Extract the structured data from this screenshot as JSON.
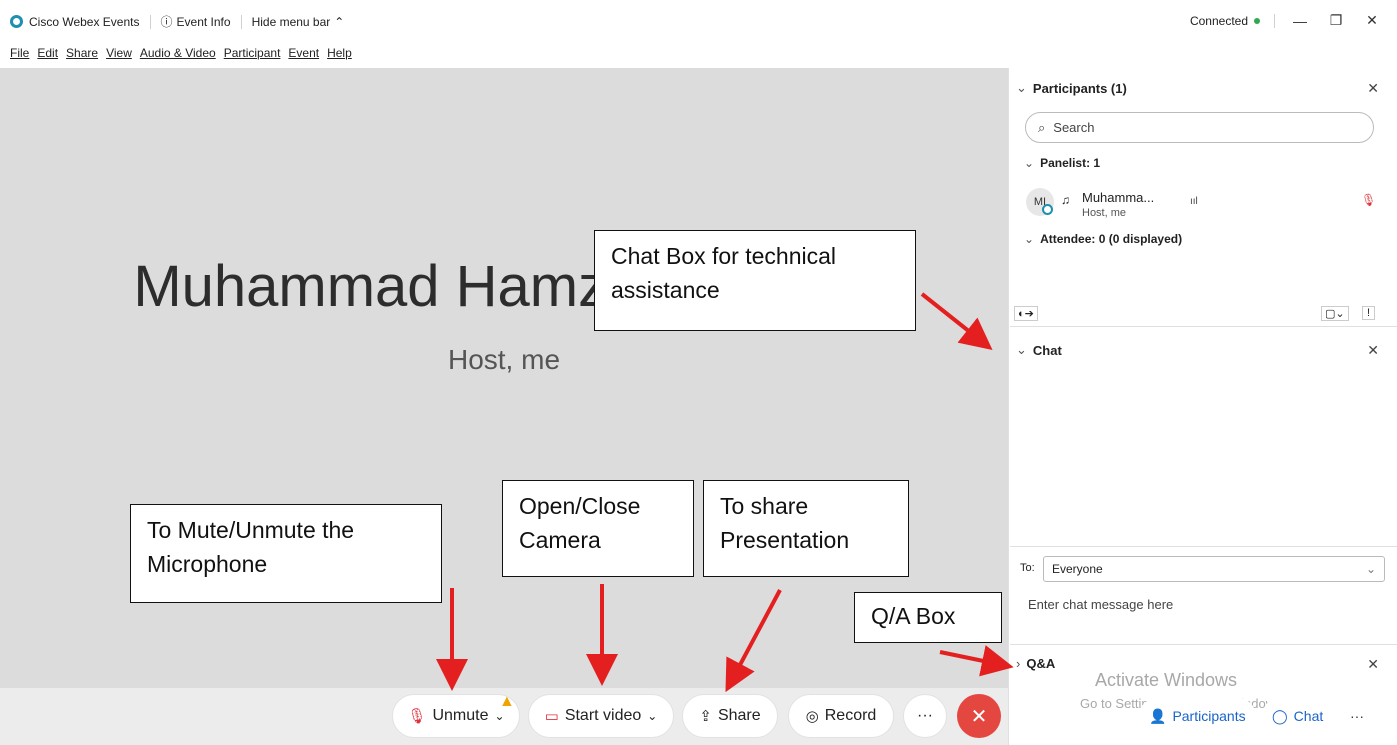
{
  "titlebar": {
    "app_title": "Cisco Webex Events",
    "event_info": "Event Info",
    "hide_menu": "Hide menu bar",
    "status": "Connected",
    "minimize": "—",
    "restore": "❐",
    "close": "✕"
  },
  "menu": [
    "File",
    "Edit",
    "Share",
    "View",
    "Audio & Video",
    "Participant",
    "Event",
    "Help"
  ],
  "stage": {
    "name": "Muhammad Hamza Ihtisham",
    "role": "Host, me"
  },
  "controls": {
    "unmute": "Unmute",
    "start_video": "Start video",
    "share": "Share",
    "record": "Record",
    "more": "···",
    "end": "✕"
  },
  "participants": {
    "header": "Participants (1)",
    "search_placeholder": "Search",
    "panelist_group": "Panelist: 1",
    "panelist_name": "Muhamma...",
    "panelist_role": "Host, me",
    "avatar_initials": "MI",
    "attendee_group": "Attendee: 0 (0 displayed)"
  },
  "chat": {
    "header": "Chat",
    "to_label": "To:",
    "to_value": "Everyone",
    "input_placeholder": "Enter chat message here"
  },
  "qa": {
    "header": "Q&A"
  },
  "sidebar_buttons": {
    "participants": "Participants",
    "chat": "Chat",
    "more": "···"
  },
  "watermark": {
    "line1": "Activate Windows",
    "line2": "Go to Settings to activate Windows."
  },
  "annotations": {
    "chat_box": "Chat Box for technical assistance",
    "mute": "To Mute/Unmute the Microphone",
    "camera": "Open/Close Camera",
    "share": "To share Presentation",
    "qa": "Q/A Box"
  },
  "colors": {
    "arrow": "#e41f1f",
    "end_button": "#e4473f",
    "accent": "#1a64c8",
    "connected": "#2fa84f"
  }
}
